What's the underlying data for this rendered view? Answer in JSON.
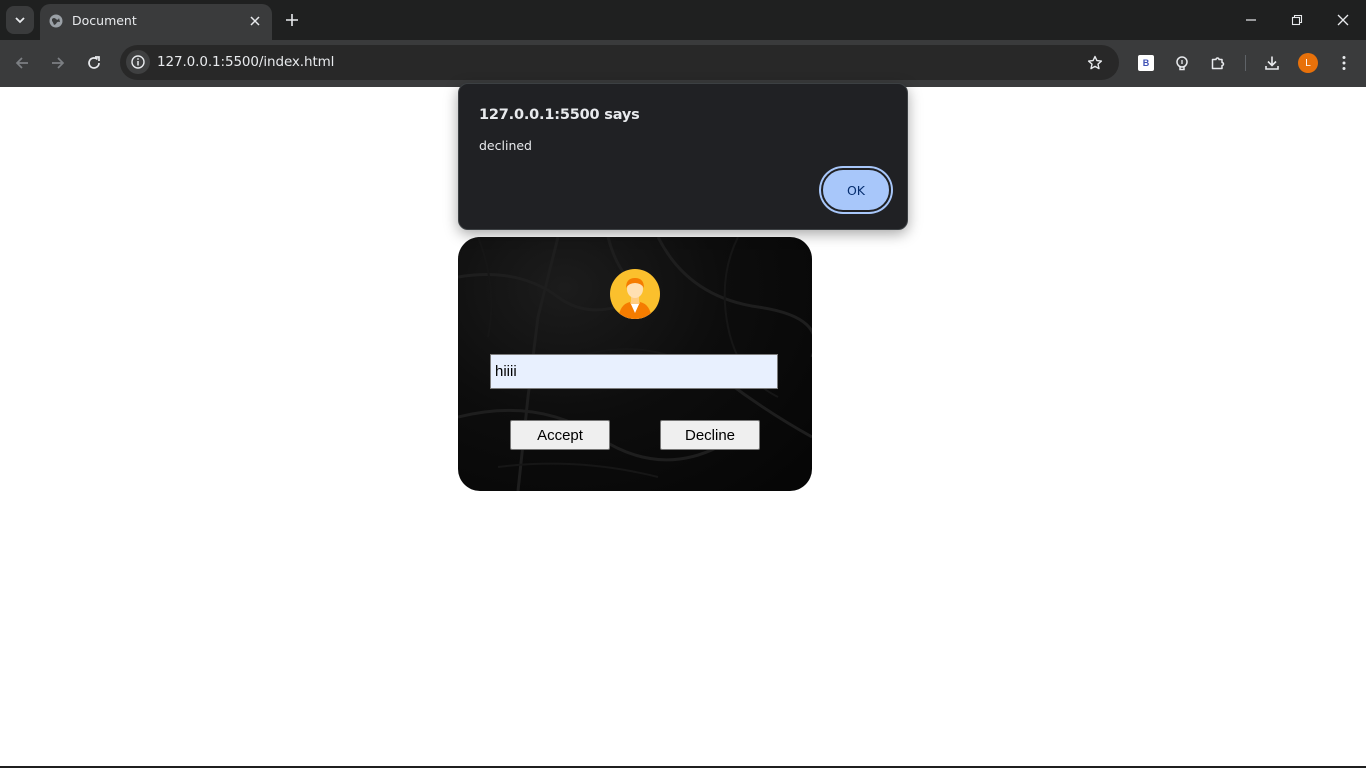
{
  "browser": {
    "tab": {
      "title": "Document"
    },
    "address_bar": {
      "url": "127.0.0.1:5500/index.html"
    },
    "profile_initial": "L",
    "extension_label": "B"
  },
  "page": {
    "input": {
      "value": "hiiii"
    },
    "buttons": {
      "accept": "Accept",
      "decline": "Decline"
    }
  },
  "alert": {
    "title": "127.0.0.1:5500 says",
    "message": "declined",
    "ok_label": "OK"
  },
  "colors": {
    "accent": "#a8c7fa",
    "avatar_badge": "#e8710a",
    "user_icon_bg": "#fbc02d"
  }
}
